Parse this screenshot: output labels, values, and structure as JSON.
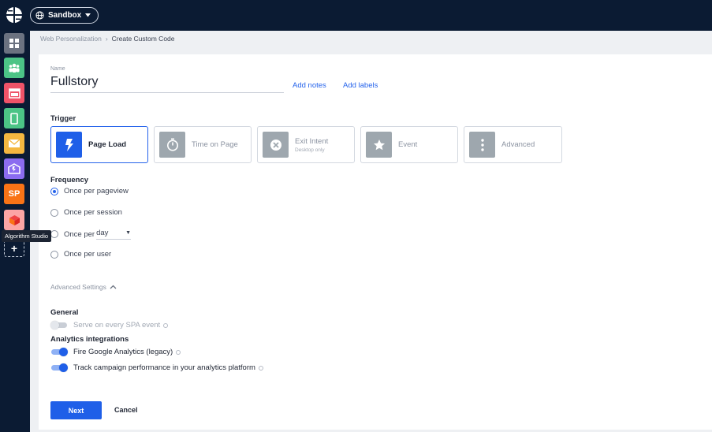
{
  "topbar": {
    "environment_label": "Sandbox",
    "environment_icon": "globe-icon",
    "dropdown_icon": "caret-down-icon"
  },
  "rail": {
    "items": [
      {
        "icon": "dashboard-grid-icon",
        "color": "#6b7280"
      },
      {
        "icon": "audience-icon",
        "color": "#4cc486"
      },
      {
        "icon": "web-personalization-icon",
        "color": "#ef5368"
      },
      {
        "icon": "mobile-icon",
        "color": "#4cc486"
      },
      {
        "icon": "email-icon",
        "color": "#f4b740"
      },
      {
        "icon": "messaging-icon",
        "color": "#8b6cf0"
      },
      {
        "label": "SP",
        "icon": "sp-icon",
        "color": "#f97316"
      },
      {
        "icon": "algorithm-studio-icon",
        "color": "#fca5a5"
      }
    ],
    "add_label": "+",
    "tooltip": "Algorithm Studio"
  },
  "breadcrumb": {
    "parent": "Web Personalization",
    "separator": "›",
    "current": "Create Custom Code"
  },
  "form": {
    "name_label": "Name",
    "name_value": "Fullstory",
    "add_notes": "Add notes",
    "add_labels": "Add labels",
    "trigger_title": "Trigger",
    "triggers": [
      {
        "label": "Page Load",
        "sub": "",
        "icon": "lightning-icon",
        "selected": true
      },
      {
        "label": "Time on Page",
        "sub": "",
        "icon": "stopwatch-icon",
        "selected": false
      },
      {
        "label": "Exit Intent",
        "sub": "Desktop only",
        "icon": "close-circle-icon",
        "selected": false
      },
      {
        "label": "Event",
        "sub": "",
        "icon": "star-icon",
        "selected": false
      },
      {
        "label": "Advanced",
        "sub": "",
        "icon": "more-vertical-icon",
        "selected": false
      }
    ],
    "frequency_title": "Frequency",
    "frequency_options": [
      {
        "label": "Once per pageview",
        "checked": true
      },
      {
        "label": "Once per session",
        "checked": false
      },
      {
        "label": "Once per",
        "period": "day",
        "checked": false
      },
      {
        "label": "Once per user",
        "checked": false
      }
    ],
    "advanced_settings_label": "Advanced Settings",
    "general_title": "General",
    "spa_label": "Serve on every SPA event",
    "spa_enabled": false,
    "analytics_title": "Analytics integrations",
    "ga_label": "Fire Google Analytics (legacy)",
    "ga_enabled": true,
    "track_label": "Track campaign performance in your analytics platform",
    "track_enabled": true,
    "next_label": "Next",
    "cancel_label": "Cancel"
  },
  "colors": {
    "accent": "#1f5fe8",
    "nav_bg": "#0b1b33",
    "link": "#2563eb"
  }
}
